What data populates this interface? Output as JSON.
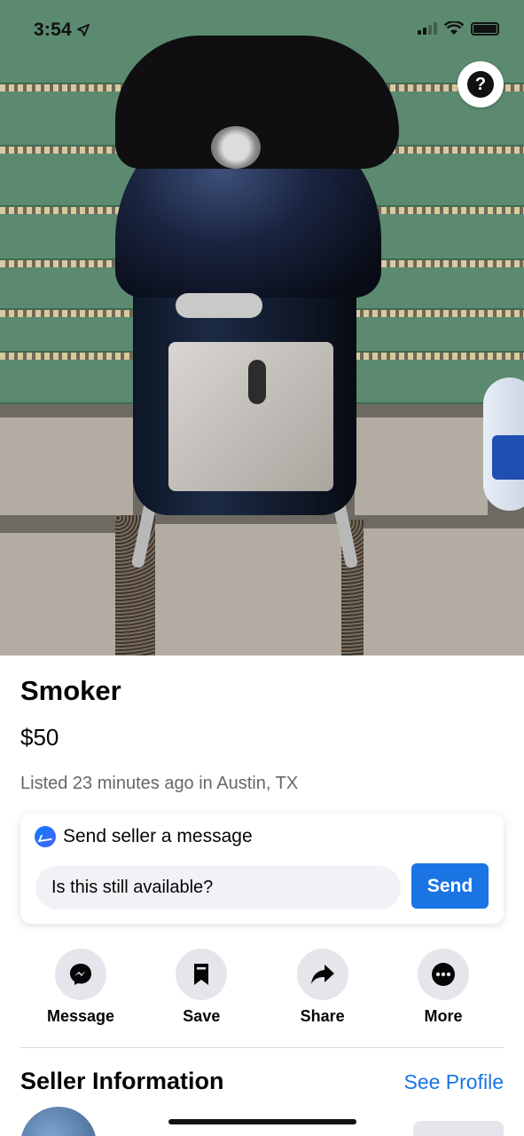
{
  "status_bar": {
    "time": "3:54",
    "icons": [
      "location-arrow-icon",
      "cellular-signal-icon",
      "wifi-icon",
      "battery-icon"
    ]
  },
  "photo": {
    "alt_description": "",
    "help_button_glyph": "?"
  },
  "listing": {
    "title": "Smoker",
    "price": "$50",
    "meta": "Listed 23 minutes ago in Austin, TX"
  },
  "message_box": {
    "heading": "Send seller a message",
    "input_value": "Is this still available?",
    "send_label": "Send",
    "accent": "#1b74e4"
  },
  "actions": [
    {
      "label": "Message",
      "icon": "messenger-icon"
    },
    {
      "label": "Save",
      "icon": "bookmark-icon"
    },
    {
      "label": "Share",
      "icon": "share-arrow-icon"
    },
    {
      "label": "More",
      "icon": "more-dots-icon"
    }
  ],
  "seller": {
    "heading": "Seller Information",
    "see_profile_label": "See Profile"
  }
}
